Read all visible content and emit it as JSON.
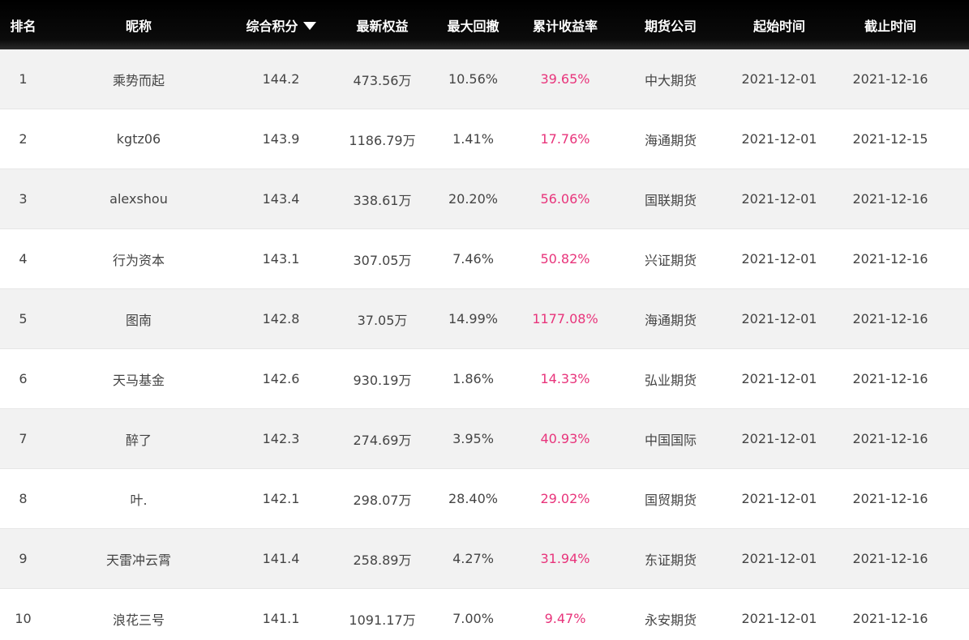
{
  "header": {
    "rank": "排名",
    "nickname": "昵称",
    "score": "综合积分",
    "equity": "最新权益",
    "drawdown": "最大回撤",
    "cum_return": "累计收益率",
    "broker": "期货公司",
    "start": "起始时间",
    "end": "截止时间"
  },
  "colors": {
    "header_bg": "#000000",
    "header_text": "#ffffff",
    "row_alt_bg": "#f2f2f2",
    "return_color": "#e8347b"
  },
  "icons": {
    "sort": "triangle-down-icon"
  },
  "rows": [
    {
      "rank": "1",
      "nickname": "乘势而起",
      "score": "144.2",
      "equity": "473.56万",
      "drawdown": "10.56%",
      "cum_return": "39.65%",
      "broker": "中大期货",
      "start": "2021-12-01",
      "end": "2021-12-16"
    },
    {
      "rank": "2",
      "nickname": "kgtz06",
      "score": "143.9",
      "equity": "1186.79万",
      "drawdown": "1.41%",
      "cum_return": "17.76%",
      "broker": "海通期货",
      "start": "2021-12-01",
      "end": "2021-12-15"
    },
    {
      "rank": "3",
      "nickname": "alexshou",
      "score": "143.4",
      "equity": "338.61万",
      "drawdown": "20.20%",
      "cum_return": "56.06%",
      "broker": "国联期货",
      "start": "2021-12-01",
      "end": "2021-12-16"
    },
    {
      "rank": "4",
      "nickname": "行为资本",
      "score": "143.1",
      "equity": "307.05万",
      "drawdown": "7.46%",
      "cum_return": "50.82%",
      "broker": "兴证期货",
      "start": "2021-12-01",
      "end": "2021-12-16"
    },
    {
      "rank": "5",
      "nickname": "图南",
      "score": "142.8",
      "equity": "37.05万",
      "drawdown": "14.99%",
      "cum_return": "1177.08%",
      "broker": "海通期货",
      "start": "2021-12-01",
      "end": "2021-12-16"
    },
    {
      "rank": "6",
      "nickname": "天马基金",
      "score": "142.6",
      "equity": "930.19万",
      "drawdown": "1.86%",
      "cum_return": "14.33%",
      "broker": "弘业期货",
      "start": "2021-12-01",
      "end": "2021-12-16"
    },
    {
      "rank": "7",
      "nickname": "醉了",
      "score": "142.3",
      "equity": "274.69万",
      "drawdown": "3.95%",
      "cum_return": "40.93%",
      "broker": "中国国际",
      "start": "2021-12-01",
      "end": "2021-12-16"
    },
    {
      "rank": "8",
      "nickname": "叶.",
      "score": "142.1",
      "equity": "298.07万",
      "drawdown": "28.40%",
      "cum_return": "29.02%",
      "broker": "国贸期货",
      "start": "2021-12-01",
      "end": "2021-12-16"
    },
    {
      "rank": "9",
      "nickname": "天雷冲云霄",
      "score": "141.4",
      "equity": "258.89万",
      "drawdown": "4.27%",
      "cum_return": "31.94%",
      "broker": "东证期货",
      "start": "2021-12-01",
      "end": "2021-12-16"
    },
    {
      "rank": "10",
      "nickname": "浪花三号",
      "score": "141.1",
      "equity": "1091.17万",
      "drawdown": "7.00%",
      "cum_return": "9.47%",
      "broker": "永安期货",
      "start": "2021-12-01",
      "end": "2021-12-16"
    }
  ]
}
